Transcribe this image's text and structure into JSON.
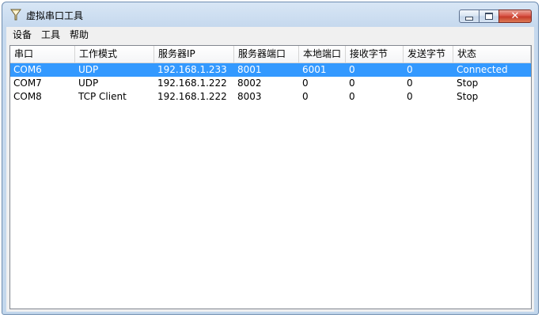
{
  "window": {
    "title": "虚拟串口工具"
  },
  "menu": {
    "items": [
      "设备",
      "工具",
      "帮助"
    ]
  },
  "table": {
    "columns": [
      "串口",
      "工作模式",
      "服务器IP",
      "服务器端口",
      "本地端口",
      "接收字节",
      "发送字节",
      "状态"
    ],
    "rows": [
      [
        "COM6",
        "UDP",
        "192.168.1.233",
        "8001",
        "6001",
        "0",
        "0",
        "Connected"
      ],
      [
        "COM7",
        "UDP",
        "192.168.1.222",
        "8002",
        "0",
        "0",
        "0",
        "Stop"
      ],
      [
        "COM8",
        "TCP Client",
        "192.168.1.222",
        "8003",
        "0",
        "0",
        "0",
        "Stop"
      ]
    ],
    "selected_row": 0
  },
  "colors": {
    "selection": "#3399ff",
    "close_button": "#c63b2a",
    "frame": "#c3d7ec"
  },
  "icons": {
    "app": "funnel-icon",
    "minimize": "minimize-icon",
    "maximize": "maximize-icon",
    "close": "close-icon"
  }
}
